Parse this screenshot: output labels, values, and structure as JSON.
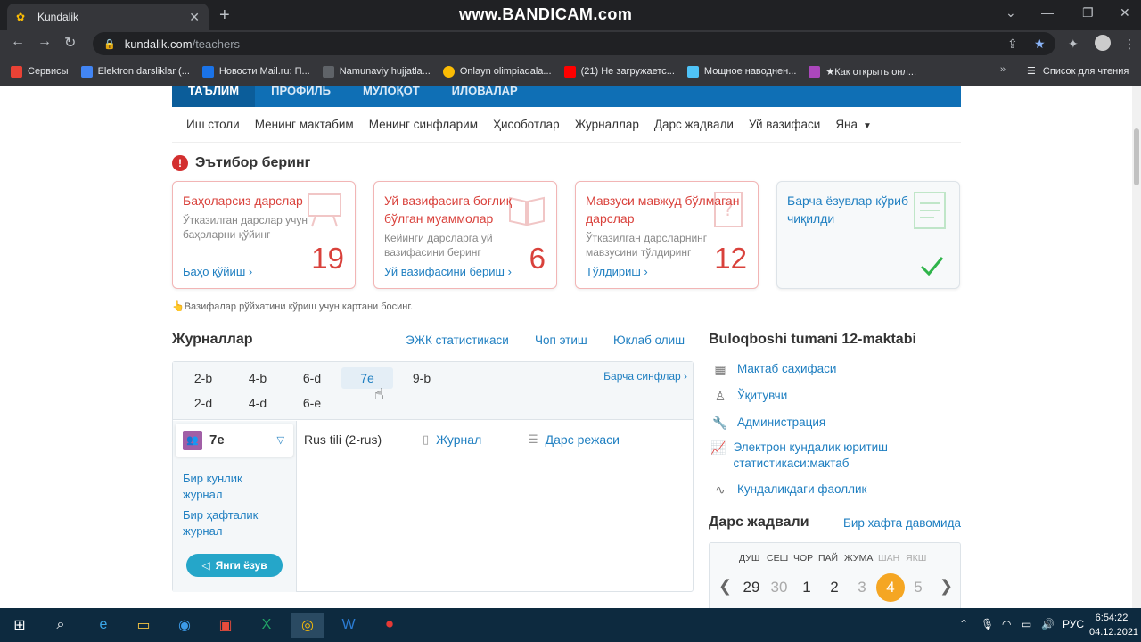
{
  "browser": {
    "tab_title": "Kundalik",
    "watermark": "www.BANDICAM.com",
    "url_host": "kundalik.com",
    "url_path": "/teachers",
    "bookmarks": [
      {
        "label": "Сервисы",
        "color": "#e94235"
      },
      {
        "label": "Elektron darsliklar (...",
        "color": "#4285f4"
      },
      {
        "label": "Новости Mail.ru: П...",
        "color": "#1a73e8"
      },
      {
        "label": "Namunaviy hujjatla...",
        "color": "#5f6368"
      },
      {
        "label": "Onlayn olimpiadala...",
        "color": "#fbbc04"
      },
      {
        "label": "(21) Не загружаетс...",
        "color": "#ff0000"
      },
      {
        "label": "Мощное наводнен...",
        "color": "#4fc3f7"
      },
      {
        "label": "★Как открыть онл...",
        "color": "#ab47bc"
      }
    ],
    "more_bookmarks": "»",
    "reading_list": "Список для чтения"
  },
  "topnav": [
    "ТАЪЛИМ",
    "ПРОФИЛЬ",
    "МУЛОҚОТ",
    "ИЛОВАЛАР"
  ],
  "subnav": [
    "Иш столи",
    "Менинг мактабим",
    "Менинг синфларим",
    "Ҳисоботлар",
    "Журналлар",
    "Дарс жадвали",
    "Уй вазифаси",
    "Яна"
  ],
  "attention": {
    "icon": "!",
    "title": "Эътибор беринг"
  },
  "cards": [
    {
      "title": "Баҳоларсиз дарслар",
      "desc": "Ўтказилган дарслар учун баҳоларни қўйинг",
      "link": "Баҳо қўйиш ›",
      "count": "19",
      "icon": "presentation-board-icon"
    },
    {
      "title": "Уй вазифасига боғлиқ бўлган муаммолар",
      "desc": "Кейинги дарсларга уй вазифасини беринг",
      "link": "Уй вазифасини бериш ›",
      "count": "6",
      "icon": "open-book-icon"
    },
    {
      "title": "Мавзуси мавжуд бўлмаган дарслар",
      "desc": "Ўтказилган дарсларнинг мавзусини тўлдиринг",
      "link": "Тўлдириш ›",
      "count": "12",
      "icon": "question-doc-icon"
    },
    {
      "title": "Барча ёзувлар кўриб чиқилди",
      "desc": "",
      "link": "",
      "count": "",
      "icon": "document-icon"
    }
  ],
  "hint": "👆Вазифалар рўйхатини кўриш учун картани босинг.",
  "journals": {
    "title": "Журналлар",
    "links": [
      "ЭЖК статистикаси",
      "Чоп этиш",
      "Юклаб олиш"
    ],
    "classes_row1": [
      "2-b",
      "4-b",
      "6-d",
      "7e",
      "9-b"
    ],
    "classes_row2": [
      "2-d",
      "4-d",
      "6-e"
    ],
    "all_classes": "Барча синфлар ›",
    "selected_class": "7e",
    "left_links": [
      "Бир кунлик журнал",
      "Бир ҳафталик журнал"
    ],
    "new_entry": "Янги ёзув",
    "subject": "Rus tili (2-rus)",
    "journal_link": "Журнал",
    "plan_link": "Дарс режаси"
  },
  "school": {
    "title": "Buloqboshi tumani 12-maktabi",
    "links": [
      "Мактаб саҳифаси",
      "Ўқитувчи",
      "Администрация",
      "Электрон кундалик юритиш статистикаси:мактаб",
      "Кундаликдаги фаоллик"
    ]
  },
  "schedule": {
    "title": "Дарс жадвали",
    "link": "Бир хафта давомида",
    "weekdays": [
      "ДУШ",
      "СЕШ",
      "ЧОР",
      "ПАЙ",
      "ЖУМА",
      "ШАН",
      "ЯКШ"
    ],
    "days": [
      "29",
      "30",
      "1",
      "2",
      "3",
      "4",
      "5"
    ]
  },
  "taskbar": {
    "lang": "РУС",
    "time": "6:54:22",
    "date": "04.12.2021"
  },
  "colors": {
    "brand": "#0f6fb5",
    "alert": "#d9413b",
    "link": "#1f7fc1",
    "today": "#f5a623"
  }
}
